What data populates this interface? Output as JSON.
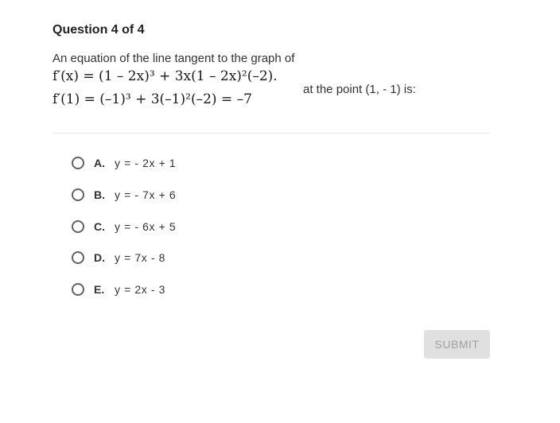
{
  "question": {
    "title": "Question 4 of 4",
    "intro": "An equation of the line tangent to the graph of",
    "math_line_1": "f′(x) = (1 – 2x)³ + 3x(1 – 2x)²(–2).",
    "math_line_2": "f′(1) = (–1)³ + 3(–1)²(–2) = –7",
    "tail": "at the point (1, - 1) is:"
  },
  "choices": [
    {
      "letter": "A.",
      "text": "y = - 2x + 1"
    },
    {
      "letter": "B.",
      "text": "y = - 7x + 6"
    },
    {
      "letter": "C.",
      "text": "y = - 6x + 5"
    },
    {
      "letter": "D.",
      "text": "y = 7x - 8"
    },
    {
      "letter": "E.",
      "text": "y = 2x - 3"
    }
  ],
  "submit_label": "SUBMIT",
  "colors": {
    "text": "#222222",
    "radio_border": "#616161",
    "submit_bg": "#e0e0e0",
    "submit_text": "#a0a0a0",
    "divider": "#e6e6e6"
  }
}
